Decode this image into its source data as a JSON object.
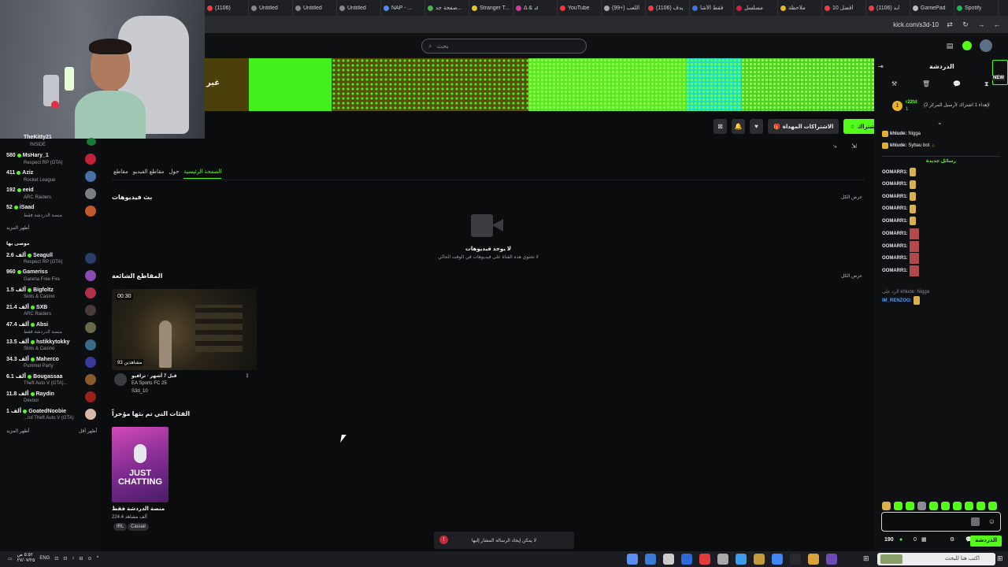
{
  "browser": {
    "tabs": [
      {
        "label": "(1106)",
        "color": "#e84040"
      },
      {
        "label": "Untitled",
        "color": "#888888"
      },
      {
        "label": "Untitled",
        "color": "#888888"
      },
      {
        "label": "Untitled",
        "color": "#888888"
      },
      {
        "label": "NAP - ...",
        "color": "#4b8bf5"
      },
      {
        "label": "صفحة جد...",
        "color": "#4caf50"
      },
      {
        "label": "Stranger T...",
        "color": "#e8c32c"
      },
      {
        "label": "Δ & ⊿",
        "color": "#d63aa1"
      },
      {
        "label": "YouTube",
        "color": "#ff3333"
      },
      {
        "label": "(99+) اللعب",
        "color": "#aaaaaa"
      },
      {
        "label": "(1106) يدف",
        "color": "#e84040"
      },
      {
        "label": "فقط الأشا",
        "color": "#3b74e0"
      },
      {
        "label": "مسلسل",
        "color": "#cc2244"
      },
      {
        "label": "ملاحظة",
        "color": "#e6b422"
      },
      {
        "label": "أفضل 10",
        "color": "#e84040"
      },
      {
        "label": "(1106) ابد",
        "color": "#e84040"
      },
      {
        "label": "GamePad",
        "color": "#bbbbbb"
      },
      {
        "label": "Spotify",
        "color": "#1db954"
      }
    ],
    "url": "kick.com/s3d-10"
  },
  "header": {
    "search_placeholder": "بحث"
  },
  "banner": {
    "text": "غير"
  },
  "actions": {
    "follow": "اشتراك",
    "gift_subs": "الاشتراكات المهداة"
  },
  "sidebar": {
    "top_partial": "TheKitty21",
    "top_partial_game": "INSIDE",
    "following": [
      {
        "count": "580",
        "name": "MsHary_1",
        "game": "Respect RP (GTA)",
        "avatar": "#c2213a"
      },
      {
        "count": "411",
        "name": "Aziz",
        "game": "Rocket League",
        "avatar": "#4b6fa8"
      },
      {
        "count": "192",
        "name": "eeid",
        "game": "ARC Raiders",
        "avatar": "#7a7f86"
      },
      {
        "count": "52",
        "name": "iSaad",
        "game": "منصة الدردشة فقط",
        "avatar": "#c05a2c"
      }
    ],
    "show_more_1": "أظهر المزيد",
    "recommended_title": "موصى بها",
    "recommended": [
      {
        "count": "2.6 ألف",
        "name": "Seagull",
        "game": "Respect RP (GTA)",
        "avatar": "#2a3d6b"
      },
      {
        "count": "960",
        "name": "Gameriss",
        "game": "Garena Free Fire",
        "avatar": "#8a4ab0"
      },
      {
        "count": "1.5 ألف",
        "name": "Bigfoltz",
        "game": "Slots & Casino",
        "avatar": "#b0304a"
      },
      {
        "count": "21.4 ألف",
        "name": "SXB",
        "game": "ARC Raiders",
        "avatar": "#4a3a3a"
      },
      {
        "count": "47.4 ألف",
        "name": "Absi",
        "game": "منصة الدردشة فقط",
        "avatar": "#6a6a4a"
      },
      {
        "count": "13.5 ألف",
        "name": "hstikkytokky",
        "game": "Slots & Casino",
        "avatar": "#3a6a8a"
      },
      {
        "count": "34.3 ألف",
        "name": "Maherco",
        "game": "Pummel Party",
        "avatar": "#3a3a9a"
      },
      {
        "count": "6.1 ألف",
        "name": "Bougassaa",
        "game": "Theft Auto V (GTA)...",
        "avatar": "#8a5a2a"
      },
      {
        "count": "11.8 ألف",
        "name": "Raydin",
        "game": "Devour",
        "avatar": "#9a2020"
      },
      {
        "count": "1 ألف",
        "name": "GoatedNoobie",
        "game": "...nd Theft Auto V (GTA)",
        "avatar": "#d8b8a8"
      }
    ],
    "show_more_2": "أظهر المزيد",
    "show_less": "أظهر أقل"
  },
  "channel": {
    "tabs": [
      "الصفحة الرئيسية",
      "حول",
      "مقاطع الفيديو",
      "مقاطع"
    ],
    "videos_title": "بث فيديوهات",
    "view_all_1": "عرض الكل",
    "empty_title": "لا يوجد فيديوهات",
    "empty_subtitle": "لا تحتوي هذه القناة على فيديوهات في الوقت الحالي",
    "clips_title": "المقاطع الشائعة",
    "view_all_2": "عرض الكل",
    "clip": {
      "duration": "00:30",
      "views": "93 مشاهدين",
      "title": "قبل 7 أشهر · ترافيو",
      "game": "EA Sports FC 25",
      "channel": "S3d_10"
    },
    "categories_title": "الفئات التي تم بثها مؤخراً",
    "category": {
      "art_text_1": "JUST",
      "art_text_2": "CHATTING",
      "name": "منصة الدردشة فقط",
      "viewers": "224.4 ألف مشاهد",
      "tags": [
        "IRL",
        "Casual"
      ]
    }
  },
  "toast": {
    "text": "لا يمكن إيجاد الرسالة المشار إليها"
  },
  "chat": {
    "title": "الدردشة",
    "new_badge": "NEW",
    "pinned": {
      "rank": "1",
      "user": "r22td",
      "count": "1",
      "text": "(لإهداء 1 اشتراك لأرسيل المركز 2"
    },
    "messages": [
      {
        "user": "khlude:",
        "text": "Nigga"
      },
      {
        "user": "khlude:",
        "text": "Sybau bot"
      }
    ],
    "new_messages": "رسائل جديدة",
    "omar_messages": 12,
    "reply_line": "الرد على khlude: Nigga",
    "last_user": "IM_RENZOO:",
    "omar_user": "OOMARR1:",
    "balance": "190",
    "count_zero": "0",
    "send": "الدردشة"
  },
  "taskbar": {
    "search": "اكتب هنا للبحث",
    "time": "٥:٥٢ ص",
    "date": "٢٧/٠٧/٢٥",
    "lang": "ENG"
  }
}
